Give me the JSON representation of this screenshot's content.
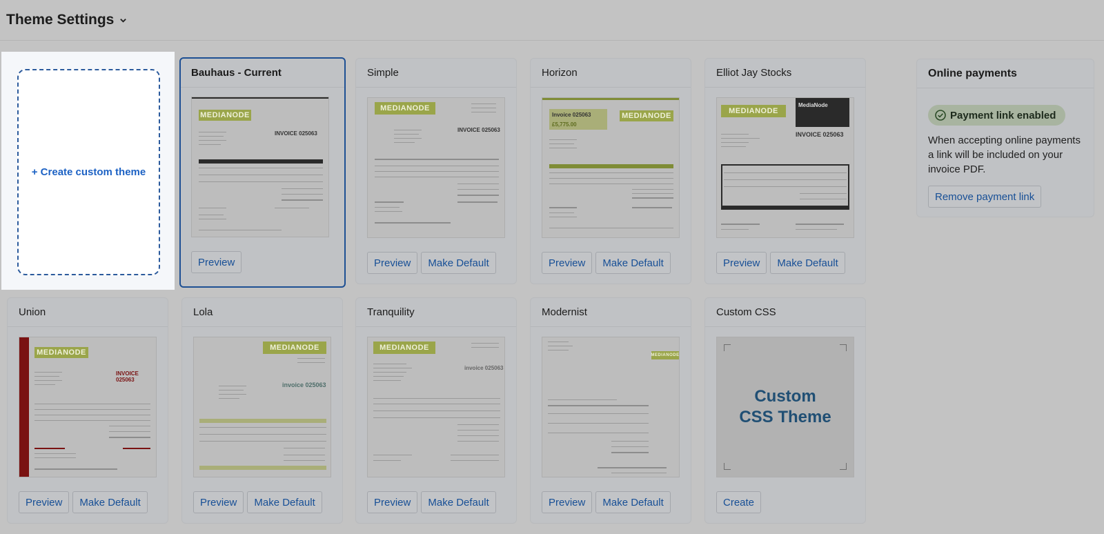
{
  "header": {
    "title": "Theme Settings"
  },
  "create_card": {
    "label": "+ Create custom theme"
  },
  "themes": [
    {
      "name": "Bauhaus - Current",
      "preview": "Preview",
      "make_default": ""
    },
    {
      "name": "Simple",
      "preview": "Preview",
      "make_default": "Make Default"
    },
    {
      "name": "Horizon",
      "preview": "Preview",
      "make_default": "Make Default"
    },
    {
      "name": "Elliot Jay Stocks",
      "preview": "Preview",
      "make_default": "Make Default"
    },
    {
      "name": "Union",
      "preview": "Preview",
      "make_default": "Make Default"
    },
    {
      "name": "Lola",
      "preview": "Preview",
      "make_default": "Make Default"
    },
    {
      "name": "Tranquility",
      "preview": "Preview",
      "make_default": "Make Default"
    },
    {
      "name": "Modernist",
      "preview": "Preview",
      "make_default": "Make Default"
    },
    {
      "name": "Custom CSS",
      "create": "Create",
      "thumb_text_1": "Custom",
      "thumb_text_2": "CSS Theme"
    }
  ],
  "thumb": {
    "logo": "MEDIANODE",
    "invoice": "INVOICE 025063",
    "invoice_lower": "invoice 025063",
    "invoice_short": "Invoice 025063",
    "amount": "£5,775.00",
    "brand": "MediaNode"
  },
  "payments": {
    "title": "Online payments",
    "badge": "Payment link enabled",
    "description": "When accepting online payments a link will be included on your invoice PDF.",
    "remove_button": "Remove payment link"
  },
  "colors": {
    "accent_blue": "#174f96",
    "selected_border": "#1d4f93",
    "badge_green": "#a8b4a0"
  }
}
